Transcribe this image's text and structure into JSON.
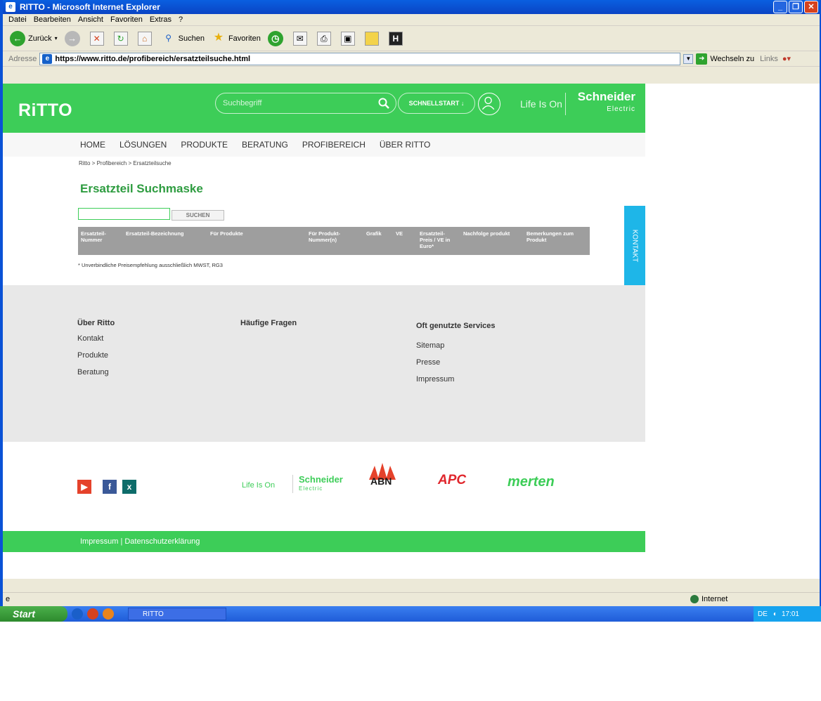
{
  "window": {
    "title": "RITTO - Microsoft Internet Explorer"
  },
  "menu": [
    "Datei",
    "Bearbeiten",
    "Ansicht",
    "Favoriten",
    "Extras",
    "?"
  ],
  "toolbar": {
    "back_label": "Zurück",
    "search_label": "Suchen",
    "favorites_label": "Favoriten"
  },
  "address": {
    "label": "Adresse",
    "url": "https://www.ritto.de/profibereich/ersatzteilsuche.html",
    "go_label": "Wechseln zu",
    "links_label": "Links"
  },
  "site": {
    "logo": "RiTTO",
    "search_placeholder": "Suchbegriff",
    "schnellstart": "SCHNELLSTART ↓",
    "life_is_on": "Life Is On",
    "schneider": "Schneider",
    "schneider_sub": "Electric",
    "nav": [
      "HOME",
      "LÖSUNGEN",
      "PRODUKTE",
      "BERATUNG",
      "PROFIBEREICH",
      "ÜBER RITTO"
    ],
    "breadcrumb": "Ritto > Profibereich > Ersatzteilsuche",
    "page_title": "Ersatzteil Suchmaske",
    "search_button": "SUCHEN",
    "table_headers": [
      "Ersatzteil-Nummer",
      "Ersatzteil-Bezeichnung",
      "Für Produkte",
      "Für Produkt-Nummer(n)",
      "Grafik",
      "VE",
      "Ersatzteil-Preis / VE in Euro*",
      "Nachfolge produkt",
      "Bemerkungen zum Produkt"
    ],
    "footnote": "* Unverbindliche Preisempfehlung ausschließlich MWST, RG3",
    "kontakt_tab": "KONTAKT"
  },
  "footer": {
    "col1": {
      "head": "Über Ritto",
      "items": [
        "Kontakt",
        "Produkte",
        "Beratung"
      ]
    },
    "col2": {
      "head": "Häufige Fragen"
    },
    "col3": {
      "head": "Oft genutzte Services",
      "items": [
        "Sitemap",
        "Presse",
        "Impressum"
      ]
    },
    "brands": {
      "life_is_on": "Life Is On",
      "schneider": "Schneider",
      "schneider_sub": "Electric",
      "abn": "ABN",
      "apc": "APC",
      "merten": "merten"
    },
    "legal": "Impressum | Datenschutzerklärung"
  },
  "status": {
    "zone": "Internet"
  },
  "taskbar": {
    "start": "Start",
    "task": "RITTO",
    "lang": "DE",
    "time": "17:01"
  },
  "colors": {
    "brand_green": "#3dcd58",
    "kontakt_blue": "#1eb6e8",
    "xp_blue": "#0a52d6"
  }
}
